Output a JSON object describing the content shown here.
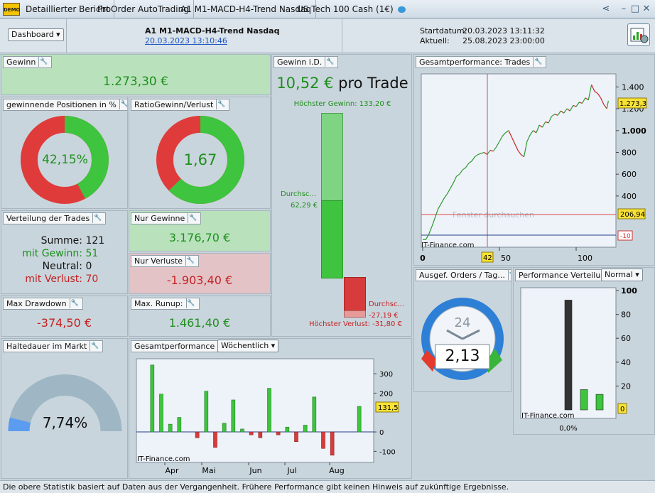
{
  "titlebar": {
    "tabs": [
      "Detaillierter Bericht",
      "ProOrder AutoTrading",
      "A1 M1-MACD-H4-Trend Nasdaq",
      "US Tech 100 Cash (1€)"
    ]
  },
  "header": {
    "dashboard_label": "Dashboard",
    "strategy_name": "A1 M1-MACD-H4-Trend Nasdaq",
    "strategy_date": "20.03.2023 13:10:46",
    "start_label": "Startdatum:",
    "start_value": "20.03.2023 13:11:32",
    "current_label": "Aktuell:",
    "current_value": "25.08.2023 23:00:00"
  },
  "gewinn": {
    "title": "Gewinn",
    "value": "1.273,30 €"
  },
  "win_pct": {
    "title": "gewinnende Positionen in %",
    "value": "42,15%",
    "fraction": 0.4215
  },
  "ratio": {
    "title": "RatioGewinn/Verlust",
    "value": "1,67",
    "fraction": 0.626
  },
  "verteilung": {
    "title": "Verteilung der Trades",
    "rows": [
      {
        "label": "Summe:",
        "value": "121"
      },
      {
        "label": "mit Gewinn:",
        "value": "51"
      },
      {
        "label": "Neutral:",
        "value": "0"
      },
      {
        "label": "mit Verlust:",
        "value": "70"
      }
    ]
  },
  "nur_gewinne": {
    "title": "Nur Gewinne",
    "value": "3.176,70 €"
  },
  "nur_verluste": {
    "title": "Nur Verluste",
    "value": "-1.903,40 €"
  },
  "max_drawdown": {
    "title": "Max Drawdown",
    "value": "-374,50 €"
  },
  "max_runup": {
    "title": "Max. Runup:",
    "value": "1.461,40 €"
  },
  "haltedauer": {
    "title": "Haltedauer im Markt",
    "value": "7,74%",
    "fraction": 0.0774
  },
  "gewinn_id": {
    "title": "Gewinn i.D.",
    "per_trade_value": "10,52 €",
    "per_trade_suffix": "pro Trade",
    "max_gain_label": "Höchster Gewinn: 133,20 €",
    "avg_gain_label": "Durchsc...",
    "avg_gain_value": "62,29 €",
    "avg_loss_label": "Durchsc...",
    "avg_loss_value": "-27,19 €",
    "max_loss_label": "Höchster Verlust: -31,80 €"
  },
  "gesamt_trades": {
    "title": "Gesamtperformance: Trades",
    "watermark": "Fenster durchsuchen",
    "credit": "IT-Finance.com",
    "y_ticks": [
      "1.400",
      "1.200",
      "1.000",
      "800",
      "600",
      "400"
    ],
    "x_ticks": [
      "0",
      "50",
      "100"
    ],
    "last_value_label": "1.273,3",
    "cursor_y_label": "206,94",
    "cursor_x_label": "42",
    "low_label": "-10"
  },
  "ausgef_orders": {
    "title": "Ausgef. Orders / Tag...",
    "clock_label": "24",
    "value": "2,13"
  },
  "perf_verteilung": {
    "title": "Performance Verteilung",
    "mode": "Normal",
    "y_ticks": [
      "100",
      "80",
      "60",
      "40",
      "20"
    ],
    "zero_label": "0",
    "credit": "IT-Finance.com",
    "x_label": "0,0%"
  },
  "gesamt_weekly": {
    "title": "Gesamtperformance",
    "period": "Wöchentlich",
    "credit": "IT-Finance.com",
    "y_ticks": [
      "300",
      "200",
      "0",
      "-100"
    ],
    "month_labels": [
      "Apr",
      "Mai",
      "Jun",
      "Jul",
      "Aug"
    ],
    "last_value_label": "131,5"
  },
  "footer": {
    "text": "Die obere Statistik basiert auf Daten aus der Vergangenheit. Frühere Performance gibt keinen Hinweis auf zukünftige Ergebnisse."
  },
  "chart_data": [
    {
      "type": "line",
      "name": "Gesamtperformance: Trades",
      "x": [
        0,
        2,
        4,
        6,
        8,
        10,
        12,
        14,
        16,
        18,
        20,
        22,
        24,
        26,
        28,
        30,
        32,
        34,
        36,
        38,
        40,
        42,
        44,
        46,
        48,
        50,
        52,
        54,
        56,
        58,
        60,
        62,
        64,
        66,
        68,
        70,
        72,
        74,
        76,
        78,
        80,
        82,
        84,
        86,
        88,
        90,
        92,
        94,
        96,
        98,
        100,
        102,
        104,
        106,
        108,
        110,
        112,
        114,
        116,
        118,
        120,
        121
      ],
      "y": [
        0,
        0,
        50,
        120,
        200,
        280,
        330,
        380,
        420,
        470,
        520,
        580,
        600,
        640,
        660,
        700,
        720,
        760,
        780,
        790,
        800,
        780,
        820,
        810,
        850,
        900,
        950,
        980,
        1000,
        940,
        880,
        820,
        780,
        760,
        900,
        960,
        1000,
        980,
        1050,
        1030,
        1080,
        1070,
        1130,
        1150,
        1140,
        1180,
        1160,
        1200,
        1180,
        1230,
        1220,
        1260,
        1250,
        1300,
        1280,
        1420,
        1360,
        1340,
        1300,
        1240,
        1200,
        1273
      ],
      "ylim": [
        -50,
        1500
      ],
      "xlim": [
        0,
        125
      ]
    },
    {
      "type": "bar",
      "name": "Gesamtperformance Wöchentlich",
      "values": [
        345,
        195,
        40,
        75,
        0,
        -30,
        210,
        -80,
        45,
        165,
        15,
        -15,
        -30,
        225,
        -15,
        25,
        -50,
        35,
        180,
        -85,
        -120,
        0,
        0,
        131.5
      ],
      "ylim": [
        -150,
        370
      ]
    },
    {
      "type": "bar",
      "name": "Performance Verteilung",
      "categories": [
        "1",
        "2",
        "3"
      ],
      "values": [
        92,
        17,
        13
      ],
      "ylim": [
        0,
        100
      ]
    }
  ]
}
